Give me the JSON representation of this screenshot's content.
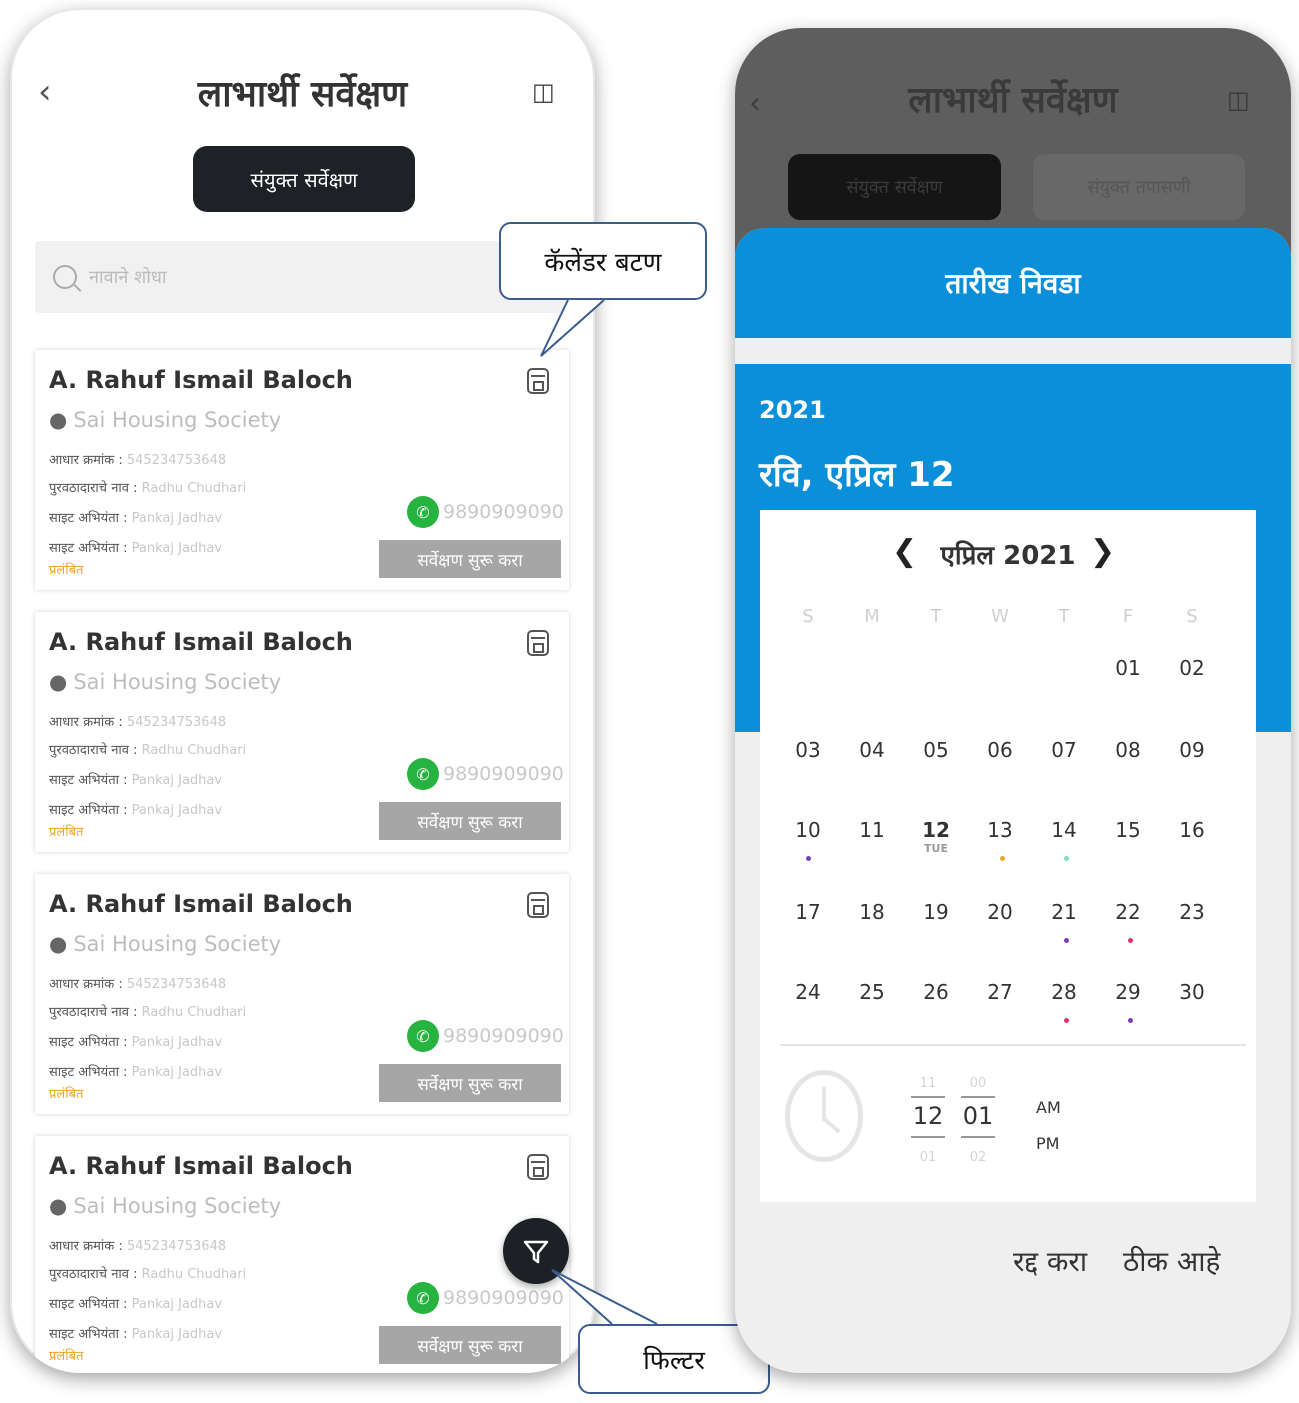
{
  "left_screen": {
    "title": "लाभार्थी सर्वेक्षण",
    "tab_label": "संयुक्त सर्वेक्षण",
    "search_placeholder": "नावाने शोधा",
    "cards": [
      {
        "name": "A. Rahuf Ismail Baloch",
        "location": "Sai Housing Society",
        "aadhaar_label": "आधार क्रमांक :",
        "aadhaar_value": "545234753648",
        "supplier_label": "पुरवठादाराचे नाव :",
        "supplier_value": "Radhu Chudhari",
        "site_officer_label": "साइट अभियंता :",
        "site_officer_value": "Pankaj Jadhav",
        "site_officer2_label": "साइट अभियंता :",
        "site_officer2_value": "Pankaj Jadhav",
        "status": "प्रलंबित",
        "phone": "9890909090",
        "start_button": "सर्वेक्षण सुरू करा"
      },
      {
        "name": "A. Rahuf Ismail Baloch",
        "location": "Sai Housing Society",
        "aadhaar_label": "आधार क्रमांक :",
        "aadhaar_value": "545234753648",
        "supplier_label": "पुरवठादाराचे नाव :",
        "supplier_value": "Radhu Chudhari",
        "site_officer_label": "साइट अभियंता :",
        "site_officer_value": "Pankaj Jadhav",
        "site_officer2_label": "साइट अभियंता :",
        "site_officer2_value": "Pankaj Jadhav",
        "status": "प्रलंबित",
        "phone": "9890909090",
        "start_button": "सर्वेक्षण सुरू करा"
      },
      {
        "name": "A. Rahuf Ismail Baloch",
        "location": "Sai Housing Society",
        "aadhaar_label": "आधार क्रमांक :",
        "aadhaar_value": "545234753648",
        "supplier_label": "पुरवठादाराचे नाव :",
        "supplier_value": "Radhu Chudhari",
        "site_officer_label": "साइट अभियंता :",
        "site_officer_value": "Pankaj Jadhav",
        "site_officer2_label": "साइट अभियंता :",
        "site_officer2_value": "Pankaj Jadhav",
        "status": "प्रलंबित",
        "phone": "9890909090",
        "start_button": "सर्वेक्षण सुरू करा"
      },
      {
        "name": "A. Rahuf Ismail Baloch",
        "location": "Sai Housing Society",
        "aadhaar_label": "आधार क्रमांक :",
        "aadhaar_value": "545234753648",
        "supplier_label": "पुरवठादाराचे नाव :",
        "supplier_value": "Radhu Chudhari",
        "site_officer_label": "साइट अभियंता :",
        "site_officer_value": "Pankaj Jadhav",
        "site_officer2_label": "साइट अभियंता :",
        "site_officer2_value": "Pankaj Jadhav",
        "status": "प्रलंबित",
        "phone": "9890909090",
        "start_button": "सर्वेक्षण सुरू करा"
      }
    ],
    "callouts": {
      "calendar_button": "कॅलेंडर बटण",
      "filter": "फिल्टर"
    }
  },
  "right_screen": {
    "title": "लाभार्थी सर्वेक्षण",
    "tab1_label": "संयुक्त सर्वेक्षण",
    "tab2_label": "संयुक्त तपासणी",
    "dialog_title": "तारीख निवडा",
    "year": "2021",
    "selected_date": "रवि, एप्रिल 12",
    "month_label": "एप्रिल 2021",
    "weekdays": [
      "S",
      "M",
      "T",
      "W",
      "T",
      "F",
      "S"
    ],
    "days": [
      [
        "",
        "",
        "",
        "",
        "",
        "01",
        "02"
      ],
      [
        "03",
        "04",
        "05",
        "06",
        "07",
        "08",
        "09"
      ],
      [
        "10",
        "11",
        "12",
        "13",
        "14",
        "15",
        "16"
      ],
      [
        "17",
        "18",
        "19",
        "20",
        "21",
        "22",
        "23"
      ],
      [
        "24",
        "25",
        "26",
        "27",
        "28",
        "29",
        "30"
      ]
    ],
    "selected_day_sub": "TUE",
    "time": {
      "hour": "12",
      "minute": "01",
      "hour_prev": "11",
      "hour_next": "01",
      "minute_prev": "00",
      "minute_next": "02",
      "am": "AM",
      "pm": "PM"
    },
    "cancel_label": "रद्द करा",
    "ok_label": "ठीक आहे"
  },
  "colors": {
    "accent_blue": "#0b8fd9",
    "dark_button": "#1e2226",
    "phone_green": "#27b33f",
    "status_orange": "#f0a32a",
    "callout_border": "#3b5c8e"
  }
}
